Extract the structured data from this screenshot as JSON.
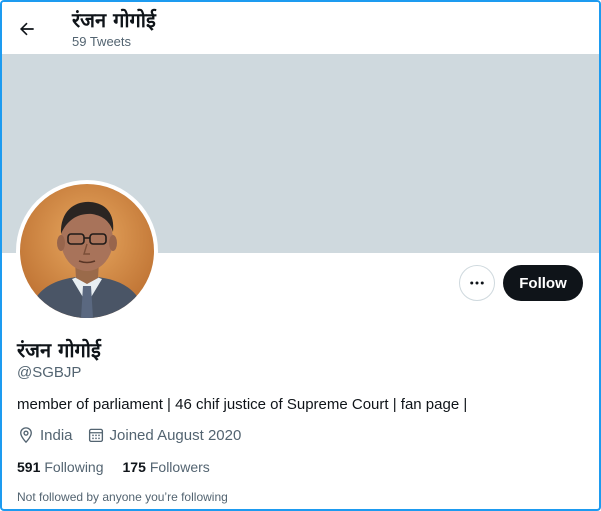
{
  "header": {
    "name": "रंजन गोगोई",
    "tweets_count": "59 Tweets"
  },
  "profile": {
    "name": "रंजन गोगोई",
    "handle": "@SGBJP",
    "bio": "member of parliament | 46 chif justice of Supreme Court | fan page |",
    "location": "India",
    "joined": "Joined August 2020",
    "following_count": "591",
    "following_label": "Following",
    "followers_count": "175",
    "followers_label": "Followers",
    "follow_note": "Not followed by anyone you’re following"
  },
  "actions": {
    "follow_label": "Follow",
    "more_icon": "more-horizontal-icon",
    "back_icon": "back-arrow-icon"
  },
  "colors": {
    "banner": "#cfd9de",
    "follow_button": "#0f1419",
    "secondary_text": "#536471",
    "frame_border": "#1d9bf0"
  }
}
